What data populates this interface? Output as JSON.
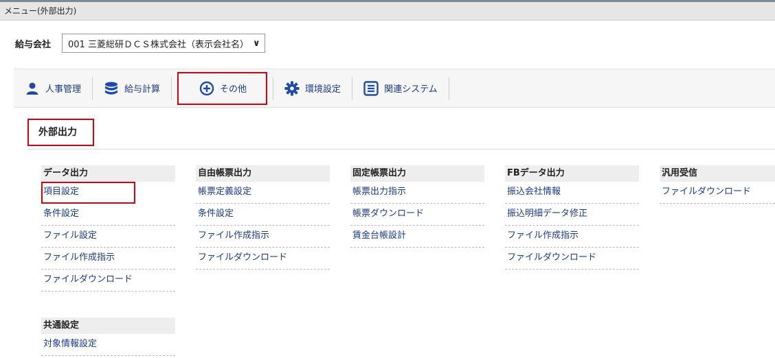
{
  "title": "メニュー(外部出力)",
  "company": {
    "label": "給与会社",
    "value": "001 三菱総研ＤＣＳ株式会社（表示会社名）"
  },
  "nav": [
    {
      "label": "人事管理",
      "icon": "person-icon"
    },
    {
      "label": "給与計算",
      "icon": "database-icon"
    },
    {
      "label": "その他",
      "icon": "plus-circle-icon"
    },
    {
      "label": "環境設定",
      "icon": "gear-icon"
    },
    {
      "label": "関連システム",
      "icon": "list-box-icon"
    }
  ],
  "section": {
    "title": "外部出力"
  },
  "columns": [
    {
      "header": "データ出力",
      "items": [
        "項目設定",
        "条件設定",
        "ファイル設定",
        "ファイル作成指示",
        "ファイルダウンロード"
      ]
    },
    {
      "header": "自由帳票出力",
      "items": [
        "帳票定義設定",
        "条件設定",
        "ファイル作成指示",
        "ファイルダウンロード"
      ]
    },
    {
      "header": "固定帳票出力",
      "items": [
        "帳票出力指示",
        "帳票ダウンロード",
        "賃金台帳設計"
      ]
    },
    {
      "header": "FBデータ出力",
      "items": [
        "振込会社情報",
        "振込明細データ修正",
        "ファイル作成指示",
        "ファイルダウンロード"
      ]
    },
    {
      "header": "汎用受信",
      "items": [
        "ファイルダウンロード"
      ]
    }
  ],
  "common": {
    "header": "共通設定",
    "items": [
      "対象情報設定"
    ]
  },
  "colors": {
    "link": "#1a3a8c",
    "icon": "#1f4aa8",
    "highlight": "#d9000d"
  }
}
